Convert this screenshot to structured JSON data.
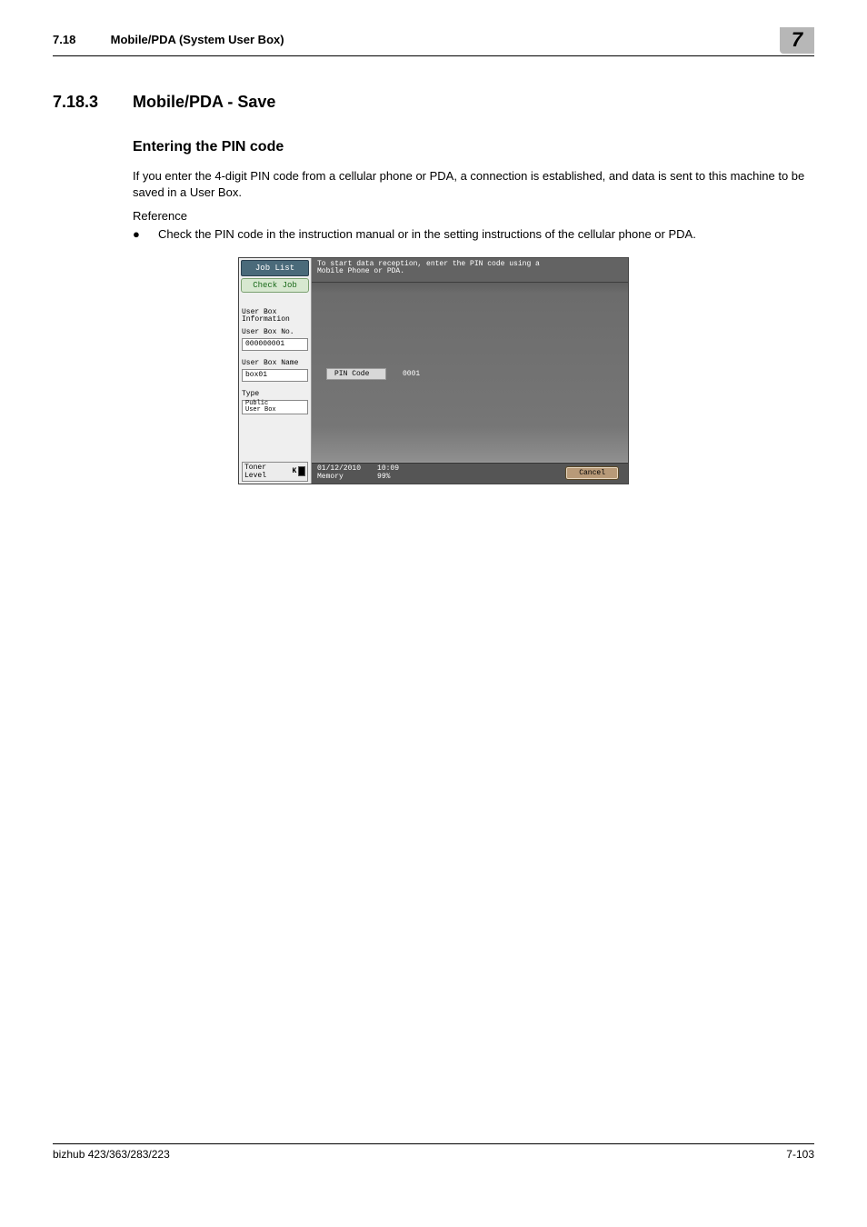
{
  "header": {
    "section_num": "7.18",
    "section_title": "Mobile/PDA (System User Box)",
    "chapter_tab": "7"
  },
  "h2": {
    "num": "7.18.3",
    "title": "Mobile/PDA -  Save"
  },
  "h3": "Entering the PIN code",
  "para1": "If you enter the 4-digit PIN code from a cellular phone or PDA, a connection is established, and data is sent to this machine to be saved in a User Box.",
  "reference_label": "Reference",
  "bullet1": "Check the PIN code in the instruction manual or in the setting instructions of the cellular phone or PDA.",
  "screenshot": {
    "job_list": "Job List",
    "check_job": "Check Job",
    "userbox_info": "User Box\nInformation",
    "userbox_no_label": "User Box No.",
    "userbox_no_value": "000000001",
    "userbox_name_label": "User Box Name",
    "userbox_name_value": "box01",
    "type_label": "Type",
    "type_value": "Public\nUser Box",
    "toner_label": "Toner Level",
    "message": "To start data reception, enter the PIN code using a\nMobile Phone or PDA.",
    "pin_label": "PIN Code",
    "pin_value": "0001",
    "date": "01/12/2010",
    "time": "10:09",
    "memory_label": "Memory",
    "memory_value": "99%",
    "cancel": "Cancel"
  },
  "footer": {
    "left": "bizhub 423/363/283/223",
    "right": "7-103"
  }
}
